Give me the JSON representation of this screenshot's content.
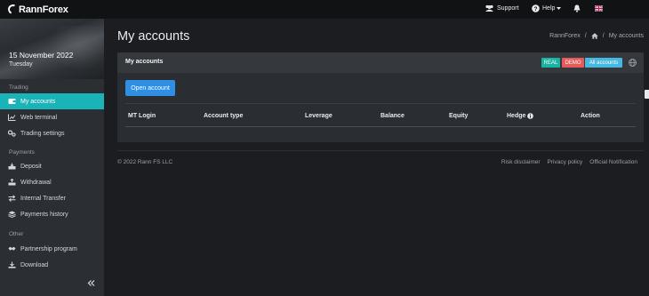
{
  "brand": {
    "name": "RannForex"
  },
  "topnav": {
    "support_label": "Support",
    "help_label": "Help",
    "language_flag": "UK flag"
  },
  "sidebar": {
    "date": "15 November 2022",
    "weekday": "Tuesday",
    "sections": [
      {
        "label": "Trading"
      },
      {
        "label": "Payments"
      },
      {
        "label": "Other"
      }
    ],
    "items": [
      {
        "label": "My accounts",
        "icon": "wallet-icon",
        "active": true
      },
      {
        "label": "Web terminal",
        "icon": "chart-icon"
      },
      {
        "label": "Trading settings",
        "icon": "settings-icon"
      },
      {
        "label": "Deposit",
        "icon": "deposit-icon"
      },
      {
        "label": "Withdrawal",
        "icon": "withdrawal-icon"
      },
      {
        "label": "Internal Transfer",
        "icon": "transfer-icon"
      },
      {
        "label": "Payments history",
        "icon": "history-icon"
      },
      {
        "label": "Partnership program",
        "icon": "handshake-icon"
      },
      {
        "label": "Download",
        "icon": "download-icon"
      }
    ],
    "collapse_icon": "double-chevron-left-icon"
  },
  "main": {
    "title": "My accounts",
    "breadcrumb": {
      "root": "RannForex",
      "separator": "/",
      "current": "My accounts"
    },
    "card": {
      "title": "My accounts",
      "filters": {
        "real": "REAL",
        "demo": "DEMO",
        "all": "All accounts"
      },
      "open_account_label": "Open account",
      "columns": [
        "MT Login",
        "Account type",
        "Leverage",
        "Balance",
        "Equity",
        "Hedge",
        "Action"
      ]
    }
  },
  "footer": {
    "copyright": "© 2022 Rann FS LLC",
    "links": [
      "Risk disclaimer",
      "Privacy policy",
      "Official Notification"
    ]
  },
  "colors": {
    "accent": "#1ab3b8",
    "primary_button": "#2e8fe5",
    "real": "#18b3a2",
    "demo": "#e75a5a",
    "all": "#47b8e0"
  }
}
